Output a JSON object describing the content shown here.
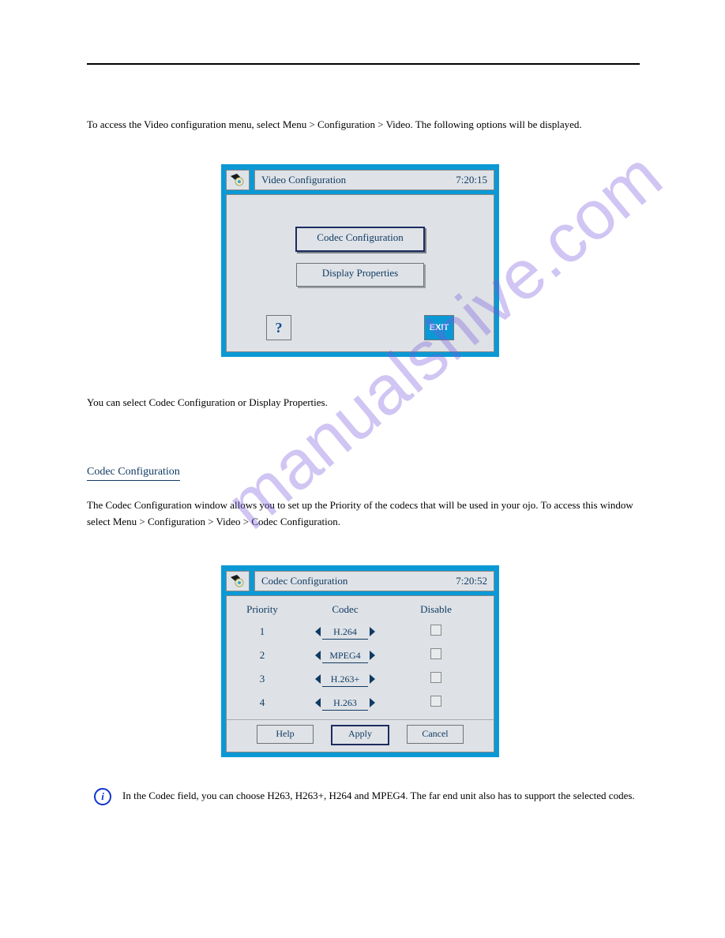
{
  "header_rule": true,
  "text1": "To access the Video configuration menu, select Menu > Configuration > Video. The following options will be displayed.",
  "window1": {
    "title": "Video Configuration",
    "time": "7:20:15",
    "btn_codec": "Codec Configuration",
    "btn_display": "Display Properties",
    "help": "?",
    "exit": "EXIT"
  },
  "text2": "You can select Codec Configuration or Display Properties.",
  "section_title": "Codec Configuration",
  "text3": "The Codec Configuration window allows you to set up the Priority of the codecs that will be used in your ojo. To access this window select Menu > Configuration > Video > Codec Configuration.",
  "window2": {
    "title": "Codec Configuration",
    "time": "7:20:52",
    "col_priority": "Priority",
    "col_codec": "Codec",
    "col_disable": "Disable",
    "rows": [
      {
        "priority": "1",
        "codec": "H.264"
      },
      {
        "priority": "2",
        "codec": "MPEG4"
      },
      {
        "priority": "3",
        "codec": "H.263+"
      },
      {
        "priority": "4",
        "codec": "H.263"
      }
    ],
    "btn_help": "Help",
    "btn_apply": "Apply",
    "btn_cancel": "Cancel"
  },
  "info_tip": "In the Codec field, you can choose H263, H263+, H264 and MPEG4. The far end unit also has to support the selected codes.",
  "watermark": "manualshive.com"
}
